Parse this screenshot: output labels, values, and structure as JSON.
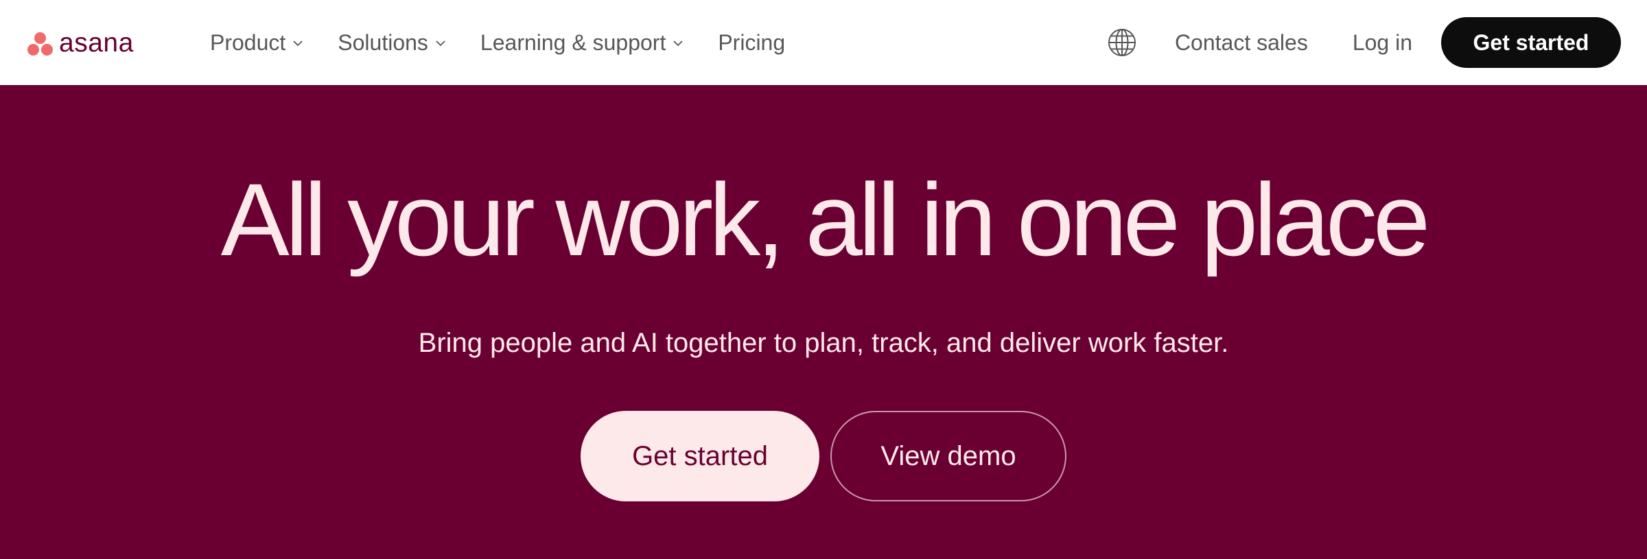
{
  "brand": {
    "name": "asana",
    "logo_color": "#f06a6a",
    "wordmark_color": "#690031"
  },
  "nav": {
    "items": [
      {
        "label": "Product",
        "has_dropdown": true
      },
      {
        "label": "Solutions",
        "has_dropdown": true
      },
      {
        "label": "Learning & support",
        "has_dropdown": true
      },
      {
        "label": "Pricing",
        "has_dropdown": false
      }
    ],
    "language_icon": "globe-icon",
    "contact_sales": "Contact sales",
    "log_in": "Log in",
    "get_started": "Get started"
  },
  "hero": {
    "title": "All your work, all in one place",
    "subtitle": "Bring people and AI together to plan, track, and deliver work faster.",
    "primary_button": "Get started",
    "secondary_button": "View demo",
    "background_color": "#6a0032",
    "text_color": "#fde9ea"
  }
}
